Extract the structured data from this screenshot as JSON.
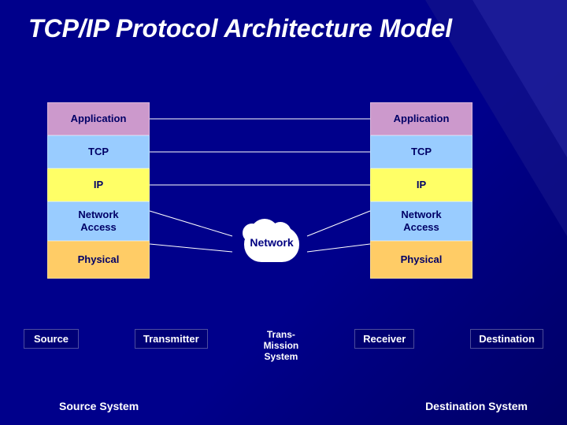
{
  "title": "TCP/IP Protocol Architecture Model",
  "layers": {
    "application": "Application",
    "tcp": "TCP",
    "ip": "IP",
    "network_access": "Network\nAccess",
    "physical": "Physical"
  },
  "center": {
    "label": "Network"
  },
  "bottom": {
    "source": "Source",
    "transmitter": "Transmitter",
    "transmission_system": "Trans-\nMission\nSystem",
    "receiver": "Receiver",
    "destination": "Destination",
    "source_system": "Source System",
    "destination_system": "Destination System"
  },
  "colors": {
    "background": "#00008B",
    "application": "#cc99cc",
    "tcp": "#99ccff",
    "ip": "#ffff66",
    "network_access": "#99ccff",
    "physical": "#ffcc66"
  }
}
